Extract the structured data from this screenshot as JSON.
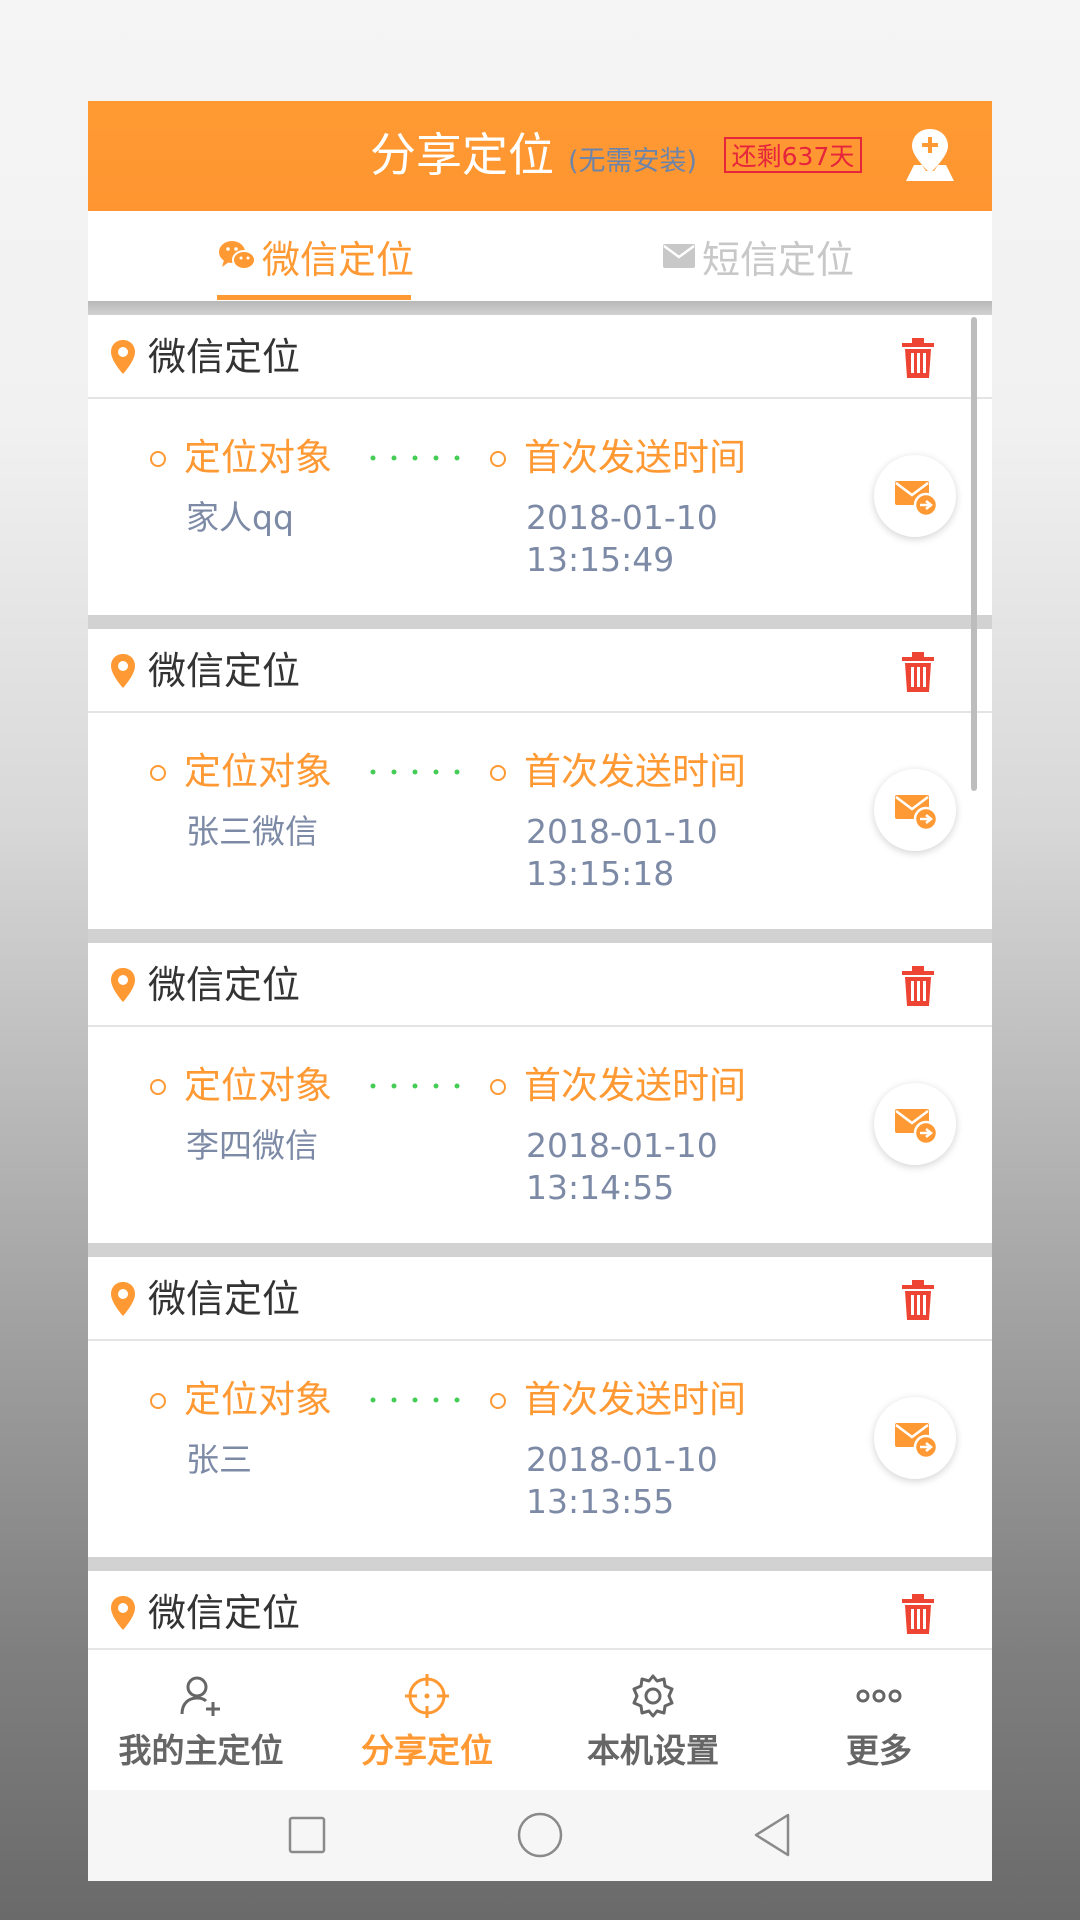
{
  "header": {
    "title": "分享定位",
    "subtitle": "(无需安装)",
    "badge": "还剩637天",
    "add_location_icon": "add-location-icon"
  },
  "tabs": [
    {
      "label": "微信定位",
      "icon": "wechat-icon",
      "active": true
    },
    {
      "label": "短信定位",
      "icon": "mail-icon",
      "active": false
    }
  ],
  "cards": [
    {
      "title": "微信定位",
      "target_label": "定位对象",
      "target_value": "家人qq",
      "time_label": "首次发送时间",
      "date": "2018-01-10",
      "time": "13:15:49"
    },
    {
      "title": "微信定位",
      "target_label": "定位对象",
      "target_value": "张三微信",
      "time_label": "首次发送时间",
      "date": "2018-01-10",
      "time": "13:15:18"
    },
    {
      "title": "微信定位",
      "target_label": "定位对象",
      "target_value": "李四微信",
      "time_label": "首次发送时间",
      "date": "2018-01-10",
      "time": "13:14:55"
    },
    {
      "title": "微信定位",
      "target_label": "定位对象",
      "target_value": "张三",
      "time_label": "首次发送时间",
      "date": "2018-01-10",
      "time": "13:13:55"
    },
    {
      "title": "微信定位"
    }
  ],
  "bottom_nav": [
    {
      "label": "我的主定位",
      "icon": "add-user-icon",
      "active": false
    },
    {
      "label": "分享定位",
      "icon": "crosshair-icon",
      "active": true
    },
    {
      "label": "本机设置",
      "icon": "gear-icon",
      "active": false
    },
    {
      "label": "更多",
      "icon": "more-icon",
      "active": false
    }
  ],
  "colors": {
    "accent": "#ff9933",
    "delete": "#ee4433",
    "muted_text": "#7d8aa6",
    "badge_red": "#e6243c",
    "dots_green": "#44cc55"
  }
}
